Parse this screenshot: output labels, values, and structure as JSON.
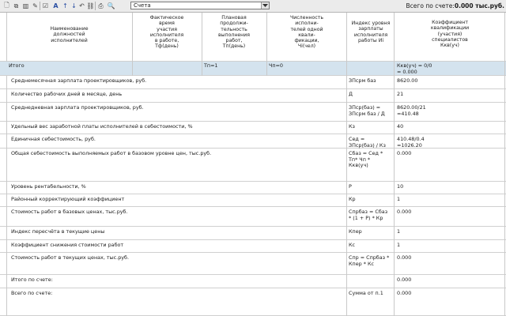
{
  "toolbar": {
    "buttons": [
      {
        "name": "new-doc-icon",
        "glyph": "🗋"
      },
      {
        "name": "copy-icon",
        "glyph": "⧉"
      },
      {
        "name": "delete-row-icon",
        "glyph": "▥"
      },
      {
        "name": "edit-icon",
        "glyph": "✎"
      },
      {
        "name": "checkbox-icon",
        "glyph": "☑"
      },
      {
        "name": "font-icon",
        "glyph": "A"
      },
      {
        "name": "arrow-up-icon",
        "glyph": "↑"
      },
      {
        "name": "arrow-down-icon",
        "glyph": "↓"
      },
      {
        "name": "undo-icon",
        "glyph": "↶"
      },
      {
        "name": "link-icon",
        "glyph": "⛓"
      },
      {
        "name": "print-icon",
        "glyph": "⎙"
      },
      {
        "name": "search-icon",
        "glyph": "🔍"
      }
    ],
    "select_value": "Счета",
    "total_prefix": "Всего по счете:",
    "total_value": "0.000 тыс.руб."
  },
  "header": {
    "col1": "Наименование\nдолжностей\nисполнителей",
    "col2": "Фактическое\nвремя\nучастия\nисполнителя\nв работе,\nТф(день)",
    "col3": "Плановая\nпродолжи-\nтельность\nвыполнения\nработ,\nТп(день)",
    "col4": "Численность\nисполни-\nтелей одной\nквали-\nфикации,\nЧi(чел)",
    "col5": "Индекс уровня\nзарплаты\nисполнителя\nработы Иi",
    "col6": "Коэффициент\nквалификации\n(участия)\nспециалистов\nКкв(уч)"
  },
  "itogo": {
    "label": "Итого",
    "tp": "Тп=1",
    "chp": "Чп=0",
    "kkv": "Ккв(уч) = 0/0\n= 0.000"
  },
  "rows": [
    {
      "name": "Среднемесячная зарплата проектировщиков, руб.",
      "code": "ЗПсрм баз",
      "value": "8620.00"
    },
    {
      "name": "Количество рабочих дней в месяце, день",
      "code": "Д",
      "value": "21"
    },
    {
      "name": "Среднедневная зарплата проектировщиков, руб.",
      "code": "ЗПср(баз) =\nЗПсрм баз / Д",
      "value": "8620.00/21\n=410.48"
    },
    {
      "name": "Удельный вес заработной платы исполнителей в себестоимости, %",
      "code": "Кз",
      "value": "40"
    },
    {
      "name": "Единичная себестоимость, руб.",
      "code": "Сед =\nЗПср(баз) / Кз",
      "value": "410.48/0.4\n=1026.20"
    },
    {
      "name": "Общая себестоимость выполняемых работ в базовом уровне цен, тыс.руб.",
      "code": "Сбаз = Сед *\nТп* Чп *\nКкв(уч)",
      "value": "0.000"
    },
    {
      "name": "Уровень рентабельности, %",
      "code": "Р",
      "value": "10"
    },
    {
      "name": "Районный корректирующий коэффициент",
      "code": "Кр",
      "value": "1"
    },
    {
      "name": "Стоимость работ в базовых ценах, тыс.руб.",
      "code": "Спрбаз = Сбаз\n* (1 + Р) * Кр",
      "value": "0.000"
    },
    {
      "name": "Индекс пересчёта в текущие цены",
      "code": "Кпер",
      "value": "1"
    },
    {
      "name": "Коэффициент снижения стоимости работ",
      "code": "Кс",
      "value": "1"
    },
    {
      "name": "Стоимость работ в текущих ценах, тыс.руб.",
      "code": "Спр = Спрбаз *\nКпер * Кс",
      "value": "0.000"
    },
    {
      "name": "Итого по счете:",
      "code": "",
      "value": "0.000"
    },
    {
      "name": "Всего по счете:",
      "code": "Сумма от п.1",
      "value": "0.000"
    }
  ],
  "colors": {
    "toolbar_bg": "#ebebeb",
    "itogo_bg": "#d4e3ee",
    "grid_line": "#c9c9c9"
  }
}
